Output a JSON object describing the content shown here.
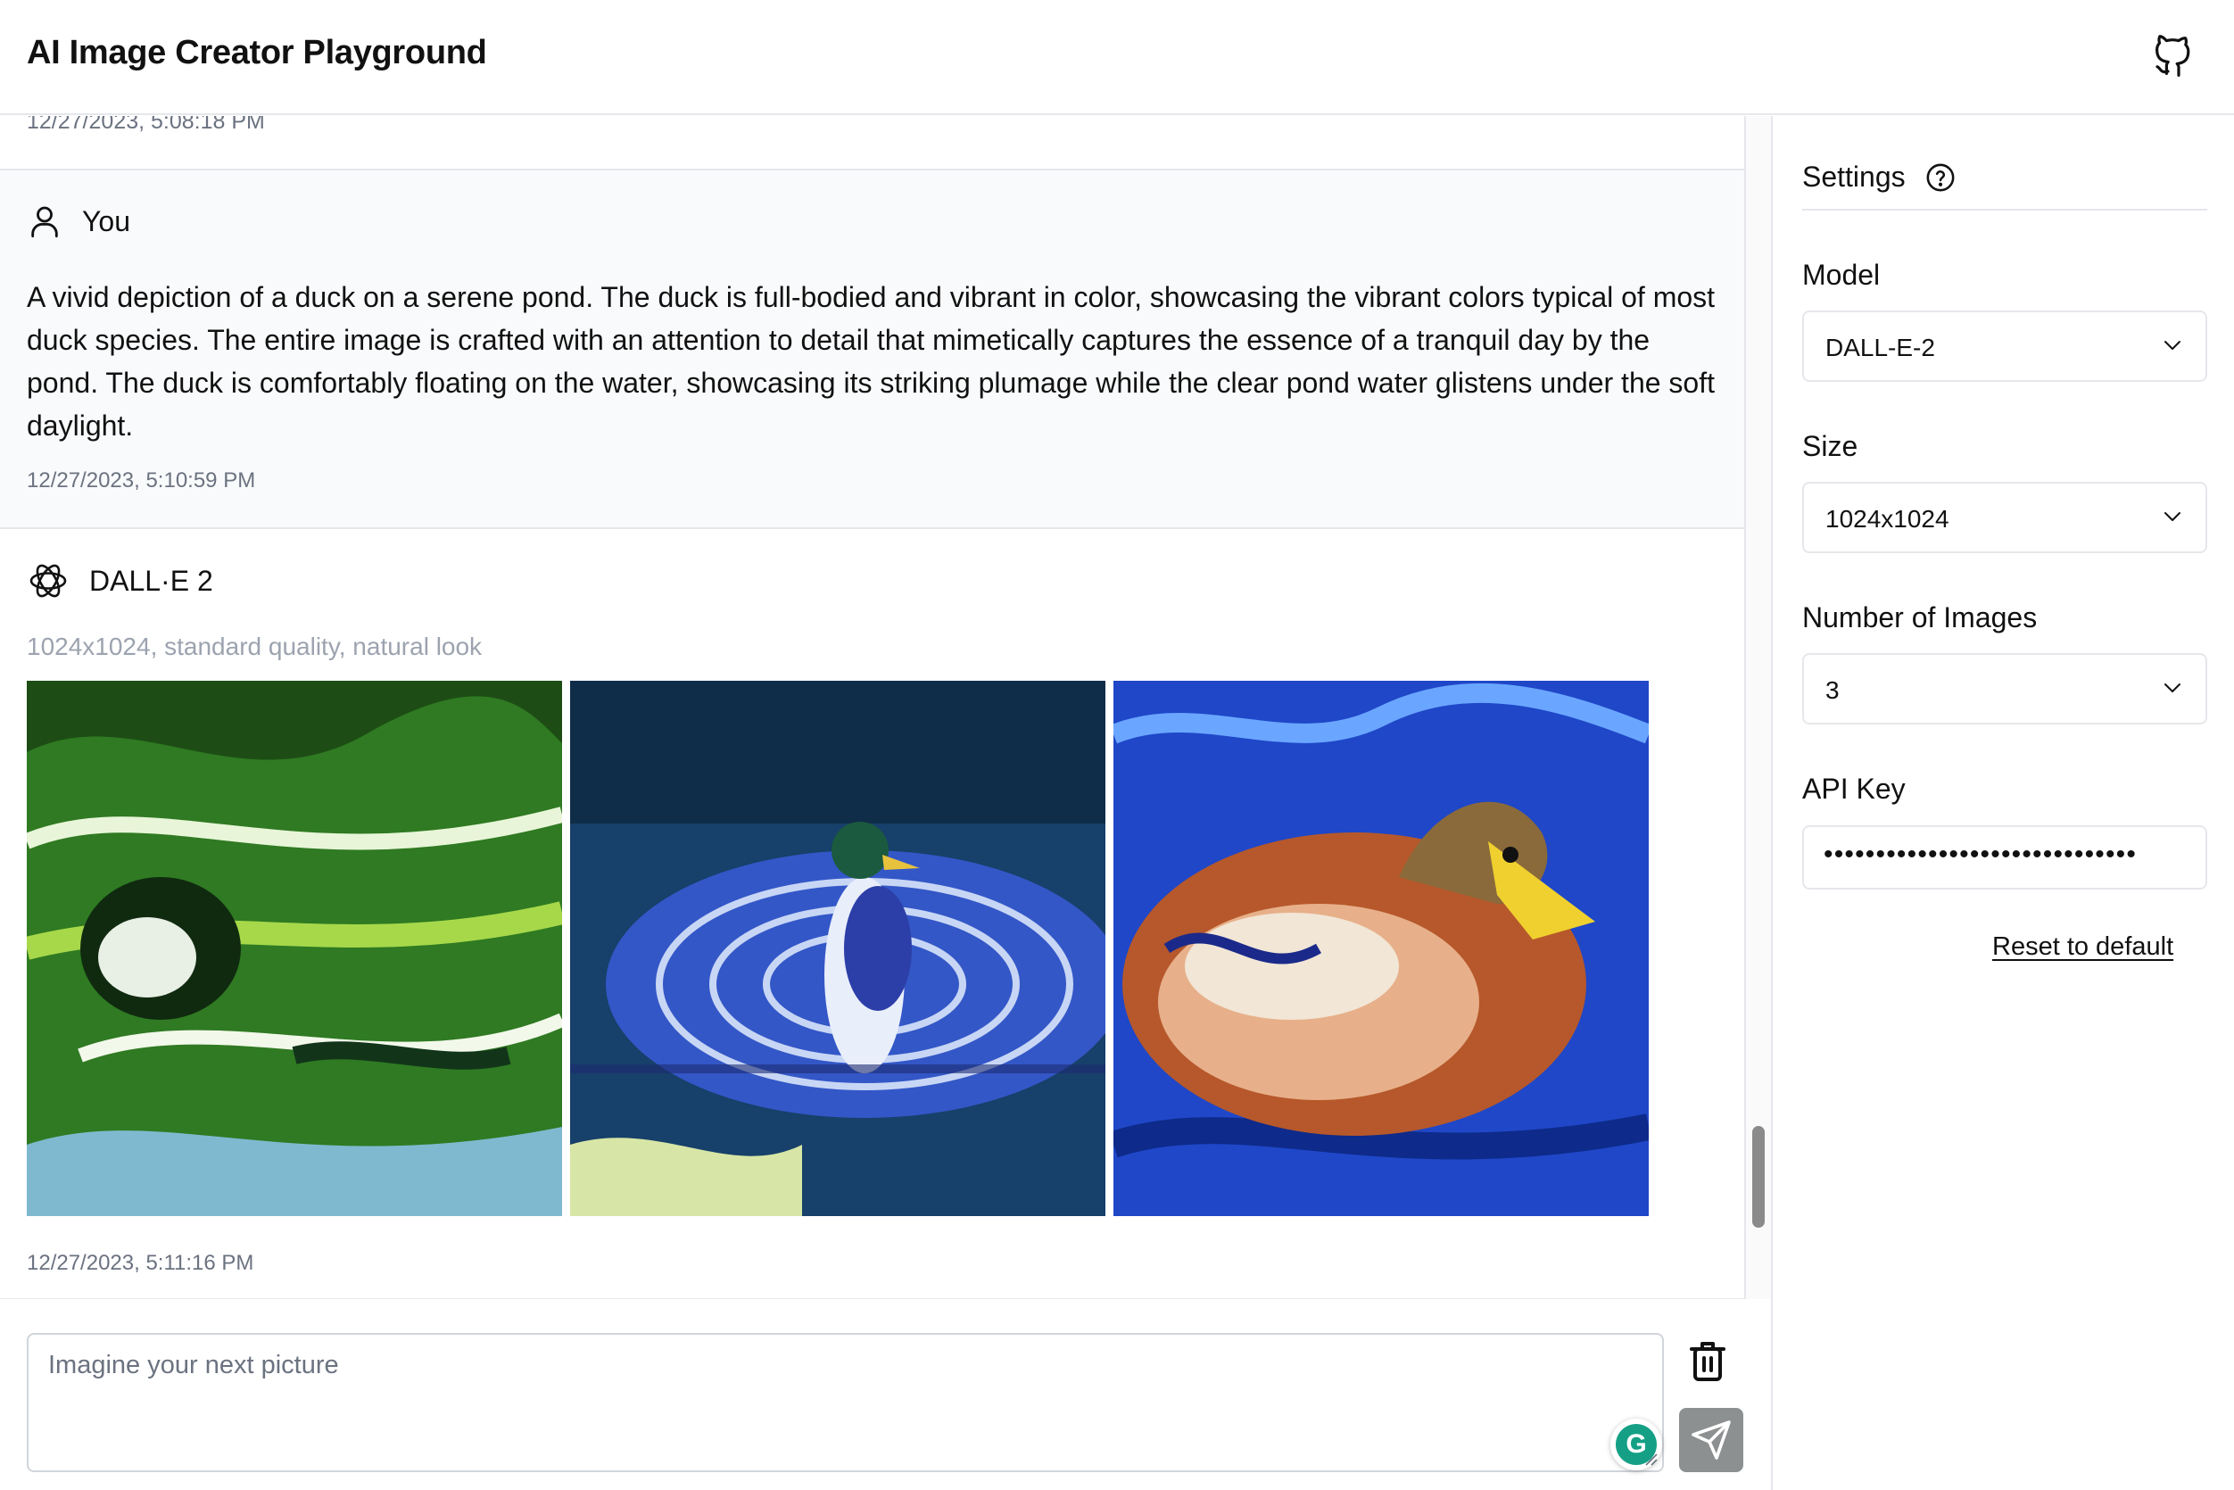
{
  "header": {
    "title": "AI Image Creator Playground",
    "github_icon": "github-icon"
  },
  "chat": {
    "previous_timestamp": "12/27/2023, 5:08:18 PM",
    "user_message": {
      "author": "You",
      "icon": "user-icon",
      "text": "A vivid depiction of a duck on a serene pond. The duck is full-bodied and vibrant in color, showcasing the vibrant colors typical of most duck species. The entire image is crafted with an attention to detail that mimetically captures the essence of a tranquil day by the pond. The duck is comfortably floating on the water, showcasing its striking plumage while the clear pond water glistens under the soft daylight.",
      "timestamp": "12/27/2023, 5:10:59 PM"
    },
    "bot_message": {
      "author": "DALL·E 2",
      "icon": "openai-logo-icon",
      "meta": "1024x1024, standard quality, natural look",
      "images": [
        {
          "name": "generated-image-1",
          "colors": [
            "#1f5a18",
            "#6cb82c",
            "#e4f0d8",
            "#2f8a3a"
          ]
        },
        {
          "name": "generated-image-2",
          "colors": [
            "#0d2a4a",
            "#3f6fd9",
            "#f0f2f8",
            "#1a3c8c"
          ]
        },
        {
          "name": "generated-image-3",
          "colors": [
            "#1b3fb5",
            "#c25a2a",
            "#f2d13a",
            "#3c86d8"
          ]
        }
      ],
      "timestamp": "12/27/2023, 5:11:16 PM"
    }
  },
  "composer": {
    "placeholder": "Imagine your next picture",
    "value": "",
    "grammarly_letter": "G"
  },
  "settings": {
    "title": "Settings",
    "model": {
      "label": "Model",
      "value": "DALL-E-2"
    },
    "size": {
      "label": "Size",
      "value": "1024x1024"
    },
    "num_images": {
      "label": "Number of Images",
      "value": "3"
    },
    "api_key": {
      "label": "API Key",
      "masked_value": "••••••••••••••••••••••••••••••"
    },
    "reset_label": "Reset to default"
  },
  "colors": {
    "border": "#e5e7eb",
    "muted_text": "#6b7280",
    "send_button": "#8d9090",
    "grammarly": "#15a086"
  }
}
